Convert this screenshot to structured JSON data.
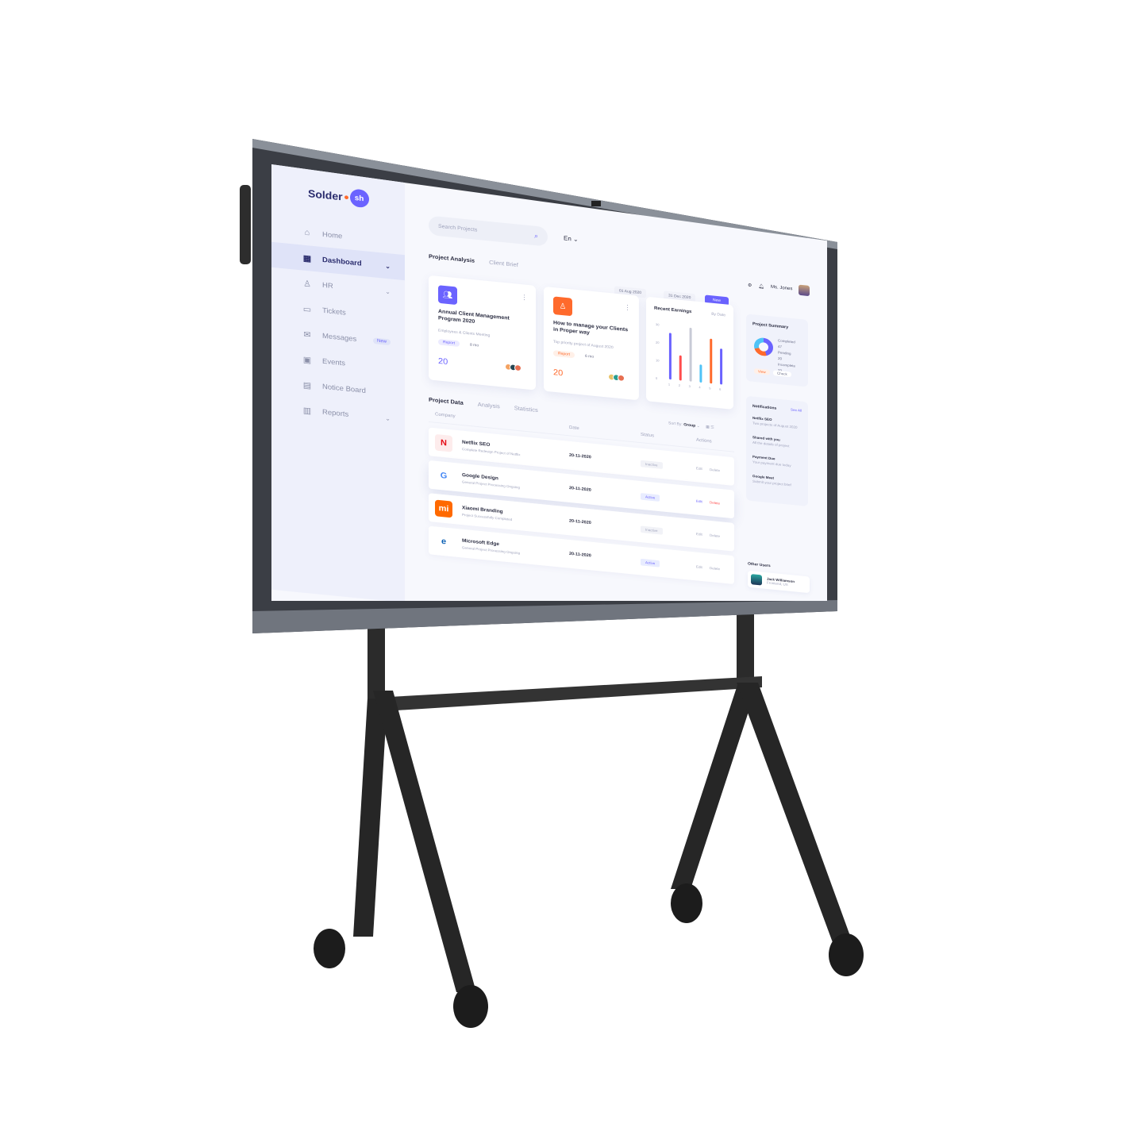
{
  "brand": {
    "name_left": "Solder",
    "name_right": "sh"
  },
  "sidebar": {
    "items": [
      {
        "label": "Home",
        "icon": "home-icon"
      },
      {
        "label": "Dashboard",
        "icon": "grid-icon",
        "active": true
      },
      {
        "label": "HR",
        "icon": "user-icon"
      },
      {
        "label": "Tickets",
        "icon": "ticket-icon"
      },
      {
        "label": "Messages",
        "icon": "message-icon",
        "badge": "New"
      },
      {
        "label": "Events",
        "icon": "calendar-icon"
      },
      {
        "label": "Notice Board",
        "icon": "board-icon"
      },
      {
        "label": "Reports",
        "icon": "report-icon"
      }
    ]
  },
  "topbar": {
    "search_placeholder": "Search Projects",
    "language": "En",
    "user_name": "Ms. Jones"
  },
  "tabs_top": [
    "Project Analysis",
    "Client Brief"
  ],
  "date_range": {
    "from": "01 Aug 2020",
    "to": "31 Dec 2020",
    "new_button": "New"
  },
  "cards": [
    {
      "title": "Annual Client Management Program 2020",
      "subtitle": "Employees & Clients Meeting",
      "tag": "Report",
      "meta": "8 mo",
      "count": "20",
      "color": "#6b63ff",
      "icon": "users-icon"
    },
    {
      "title": "How to manage your Clients in Proper way",
      "subtitle": "Top priority project of August 2020",
      "tag": "Report",
      "meta": "6 mo",
      "count": "20",
      "color": "#ff6a2c",
      "icon": "user-icon"
    }
  ],
  "earnings": {
    "title": "Recent Earnings",
    "selector": "By Date",
    "chart_data": {
      "type": "bar",
      "categories": [
        "1",
        "2",
        "3",
        "4",
        "5",
        "6"
      ],
      "series": [
        {
          "values": [
            26,
            14,
            30,
            10,
            25,
            20
          ]
        }
      ],
      "ylim": [
        0,
        30
      ],
      "colors": [
        "#6b63ff",
        "#ff4d4d",
        "#c8cad6",
        "#4fc3f7",
        "#ff6a2c",
        "#6b63ff"
      ]
    }
  },
  "summary": {
    "title": "Project Summary",
    "legend": [
      {
        "label": "Completed",
        "value": "47"
      },
      {
        "label": "Pending",
        "value": "20"
      },
      {
        "label": "Incomplete",
        "value": "33"
      }
    ],
    "buttons": [
      "View",
      "Check"
    ]
  },
  "data_tabs": [
    "Project Data",
    "Analysis",
    "Statistics"
  ],
  "table": {
    "sort_label": "Sort By:",
    "sort_value": "Group",
    "headers": [
      "Company",
      "Date",
      "Status",
      "Actions"
    ],
    "rows": [
      {
        "name": "Netflix SEO",
        "desc": "Complete Redesign Project of Netflix",
        "date": "20-11-2020",
        "status": "Inactive",
        "logo": "N",
        "logo_color": "#e50914",
        "logo_bg": "#fdecec"
      },
      {
        "name": "Google Design",
        "desc": "General Project Processing Ongoing",
        "date": "20-11-2020",
        "status": "Active",
        "logo": "G",
        "logo_color": "#4285f4",
        "logo_bg": "#ffffff"
      },
      {
        "name": "Xiaomi Branding",
        "desc": "Project Successfully Completed",
        "date": "20-11-2020",
        "status": "Inactive",
        "logo": "mi",
        "logo_color": "#ffffff",
        "logo_bg": "#ff6900"
      },
      {
        "name": "Microsoft Edge",
        "desc": "General Project Processing Ongoing",
        "date": "20-11-2020",
        "status": "Active",
        "logo": "e",
        "logo_color": "#0a5fb4",
        "logo_bg": "#ffffff"
      }
    ],
    "edit_label": "Edit",
    "delete_label": "Delete"
  },
  "notifications": {
    "title": "Notifications",
    "see_all": "See All",
    "items": [
      {
        "title": "Netflix SEO",
        "sub": "Two projects of August 2020"
      },
      {
        "title": "Shared with you",
        "sub": "All the details of project"
      },
      {
        "title": "Payment Due",
        "sub": "Your payment due today"
      },
      {
        "title": "Google Meet",
        "sub": "Submit your project brief"
      }
    ]
  },
  "other_users": {
    "title": "Other Users",
    "name": "Jack Williamson",
    "role": "Frontend, UX"
  }
}
